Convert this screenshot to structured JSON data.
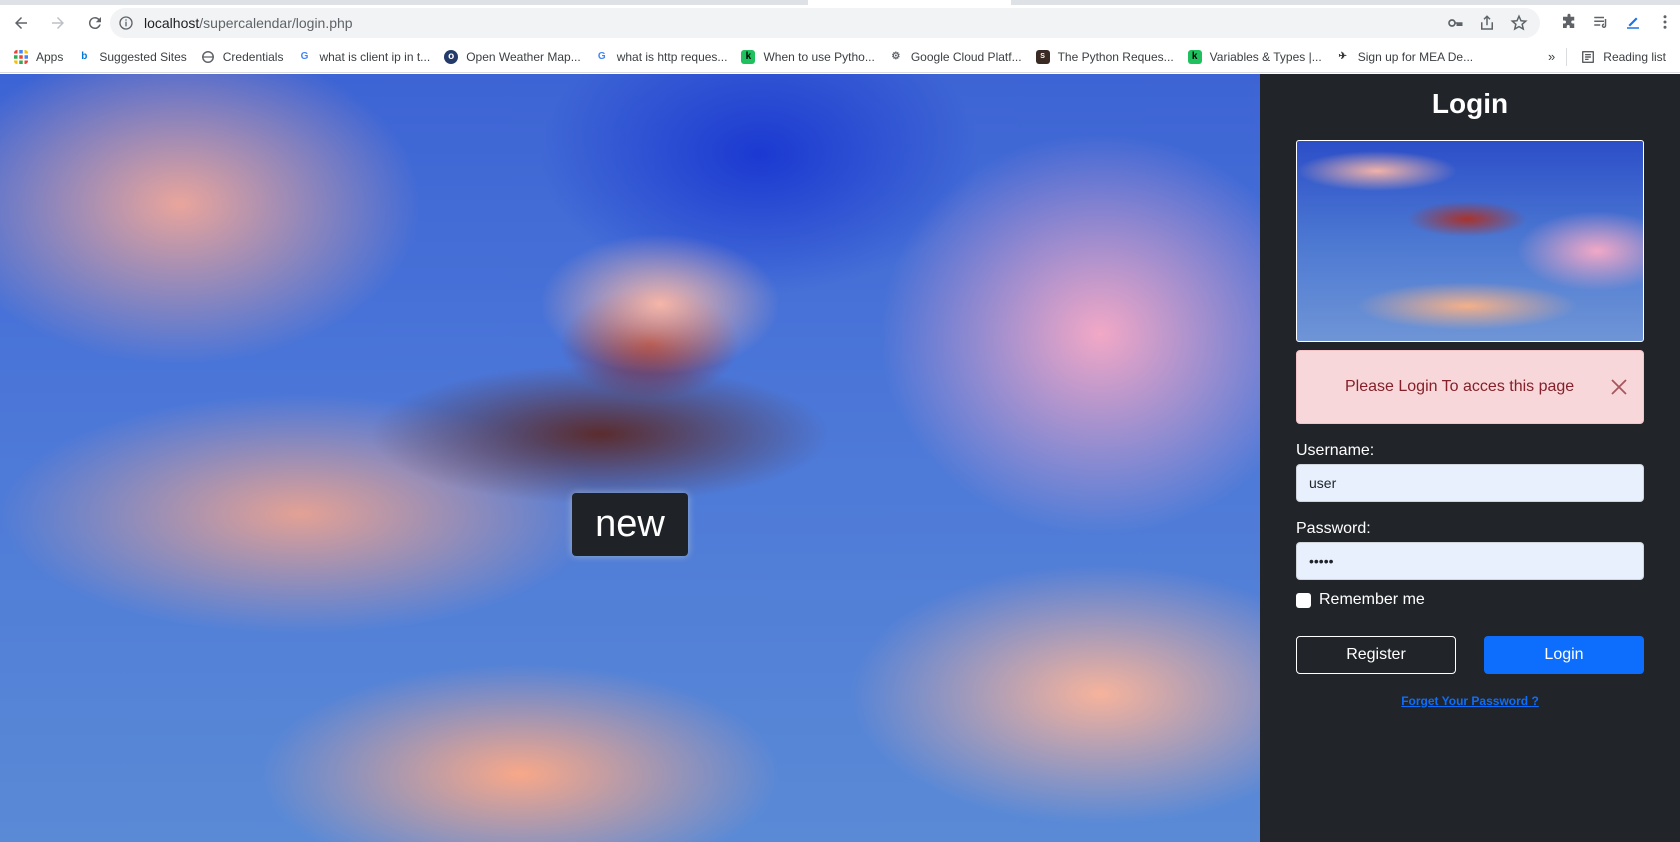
{
  "browser": {
    "url_host": "localhost",
    "url_path": "/supercalendar/login.php",
    "bookmarks": [
      {
        "label": "Apps",
        "icon": "apps-grid-icon"
      },
      {
        "label": "Suggested Sites",
        "icon": "bing-icon"
      },
      {
        "label": "Credentials",
        "icon": "globe-icon"
      },
      {
        "label": "what is client ip in t...",
        "icon": "google-icon"
      },
      {
        "label": "Open Weather Map...",
        "icon": "weather-icon"
      },
      {
        "label": "what is http reques...",
        "icon": "google-icon"
      },
      {
        "label": "When to use Pytho...",
        "icon": "site-icon"
      },
      {
        "label": "Google Cloud Platf...",
        "icon": "gear-icon"
      },
      {
        "label": "The Python Reques...",
        "icon": "site-icon"
      },
      {
        "label": "Variables & Types |...",
        "icon": "site-icon"
      },
      {
        "label": "Sign up for MEA De...",
        "icon": "site-icon"
      }
    ],
    "reading_list": "Reading list",
    "more_bookmarks": "»"
  },
  "hero": {
    "badge": "new"
  },
  "login": {
    "title": "Login",
    "alert": "Please Login To acces this page",
    "username_label": "Username:",
    "username_value": "user",
    "password_label": "Password:",
    "password_value": "•••••",
    "remember_label": "Remember me",
    "register_button": "Register",
    "login_button": "Login",
    "forgot_link": "Forget Your Password ?"
  },
  "colors": {
    "panel_bg": "#212529",
    "primary": "#0d6efd",
    "alert_bg": "#f8d7da",
    "alert_text": "#842029"
  }
}
